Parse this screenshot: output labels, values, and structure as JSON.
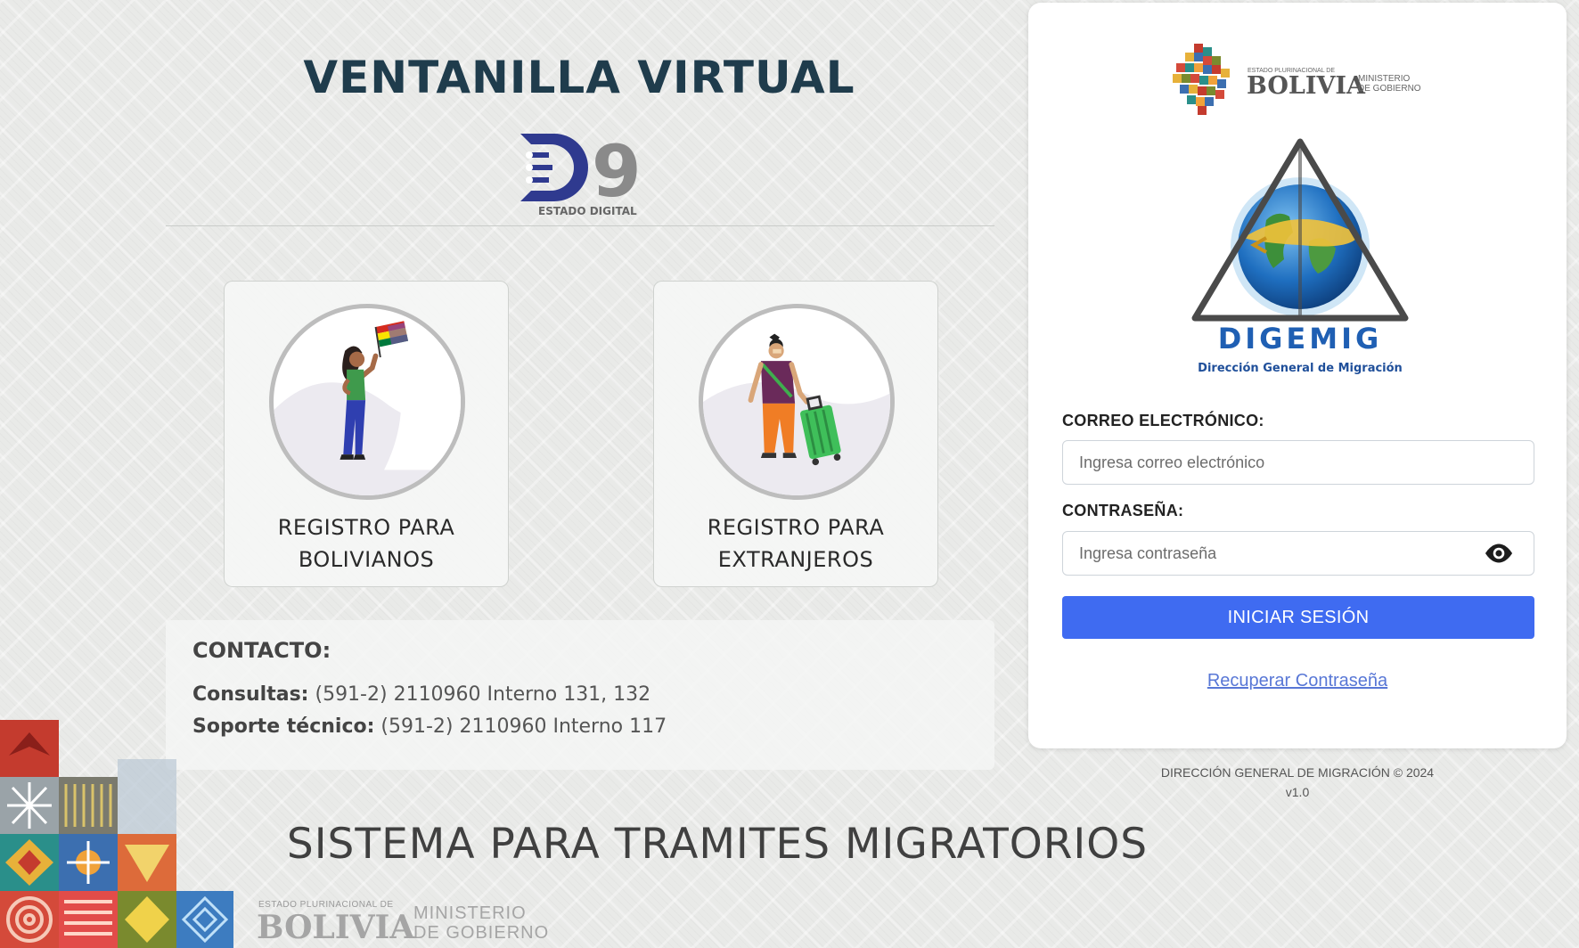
{
  "header": {
    "title": "VENTANILLA VIRTUAL",
    "logo_text": "ESTADO DIGITAL",
    "logo_number": "9"
  },
  "registration": {
    "bolivianos": {
      "line1": "REGISTRO PARA",
      "line2": "BOLIVIANOS"
    },
    "extranjeros": {
      "line1": "REGISTRO PARA",
      "line2": "EXTRANJEROS"
    }
  },
  "contact": {
    "title": "CONTACTO:",
    "consultas_label": "Consultas:",
    "consultas_value": "(591-2) 2110960 Interno 131, 132",
    "soporte_label": "Soporte técnico:",
    "soporte_value": "(591-2) 2110960 Interno 117"
  },
  "footer": {
    "system_title": "SISTEMA PARA TRAMITES MIGRATORIOS",
    "logo_small": "ESTADO PLURINACIONAL DE",
    "logo_big": "BOLIVIA",
    "logo_ministry_1": "MINISTERIO",
    "logo_ministry_2": "DE GOBIERNO"
  },
  "login": {
    "gov_logo_small": "ESTADO PLURINACIONAL DE",
    "gov_logo_big": "BOLIVIA",
    "gov_ministry_1": "MINISTERIO",
    "gov_ministry_2": "DE GOBIERNO",
    "digemig_name": "DIGEMIG",
    "digemig_subtitle": "Dirección General de Migración",
    "email_label": "CORREO ELECTRÓNICO:",
    "email_placeholder": "Ingresa correo electrónico",
    "password_label": "CONTRASEÑA:",
    "password_placeholder": "Ingresa contraseña",
    "submit_label": "INICIAR SESIÓN",
    "recover_label": "Recuperar Contraseña"
  },
  "copyright": {
    "line1": "DIRECCIÓN GENERAL DE MIGRACIÓN © 2024",
    "version": "v1.0"
  },
  "colors": {
    "primary_button": "#3f6bf1",
    "link": "#5877d6",
    "title": "#1f3c4c",
    "digemig_blue": "#1f5fb3",
    "digemig_orange": "#f08a1d"
  },
  "icons": {
    "password_toggle": "eye-icon"
  }
}
